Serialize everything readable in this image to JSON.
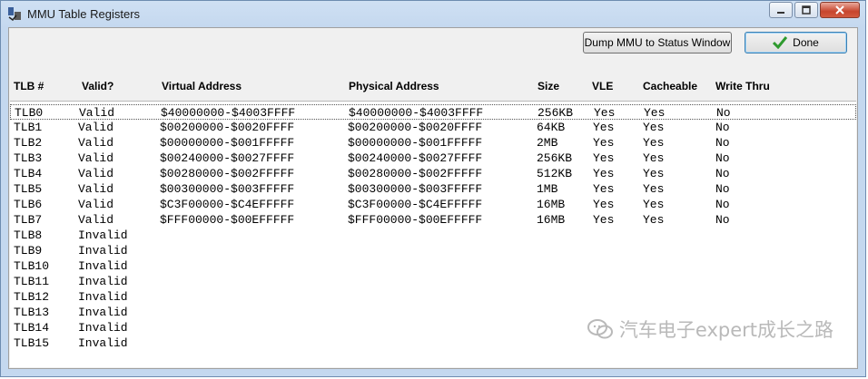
{
  "window": {
    "title": "MMU Table Registers",
    "buttons": {
      "dump": "Dump MMU to Status Window",
      "done": "Done"
    }
  },
  "columns": [
    "TLB #",
    "Valid?",
    "Virtual Address",
    "Physical Address",
    "Size",
    "VLE",
    "Cacheable",
    "Write Thru"
  ],
  "rows": [
    [
      "TLB0",
      "Valid",
      "$40000000-$4003FFFF",
      "$40000000-$4003FFFF",
      "256KB",
      "Yes",
      "Yes",
      "No"
    ],
    [
      "TLB1",
      "Valid",
      "$00200000-$0020FFFF",
      "$00200000-$0020FFFF",
      "64KB",
      "Yes",
      "Yes",
      "No"
    ],
    [
      "TLB2",
      "Valid",
      "$00000000-$001FFFFF",
      "$00000000-$001FFFFF",
      "2MB",
      "Yes",
      "Yes",
      "No"
    ],
    [
      "TLB3",
      "Valid",
      "$00240000-$0027FFFF",
      "$00240000-$0027FFFF",
      "256KB",
      "Yes",
      "Yes",
      "No"
    ],
    [
      "TLB4",
      "Valid",
      "$00280000-$002FFFFF",
      "$00280000-$002FFFFF",
      "512KB",
      "Yes",
      "Yes",
      "No"
    ],
    [
      "TLB5",
      "Valid",
      "$00300000-$003FFFFF",
      "$00300000-$003FFFFF",
      "1MB",
      "Yes",
      "Yes",
      "No"
    ],
    [
      "TLB6",
      "Valid",
      "$C3F00000-$C4EFFFFF",
      "$C3F00000-$C4EFFFFF",
      "16MB",
      "Yes",
      "Yes",
      "No"
    ],
    [
      "TLB7",
      "Valid",
      "$FFF00000-$00EFFFFF",
      "$FFF00000-$00EFFFFF",
      "16MB",
      "Yes",
      "Yes",
      "No"
    ],
    [
      "TLB8",
      "Invalid",
      "",
      "",
      "",
      "",
      "",
      ""
    ],
    [
      "TLB9",
      "Invalid",
      "",
      "",
      "",
      "",
      "",
      ""
    ],
    [
      "TLB10",
      "Invalid",
      "",
      "",
      "",
      "",
      "",
      ""
    ],
    [
      "TLB11",
      "Invalid",
      "",
      "",
      "",
      "",
      "",
      ""
    ],
    [
      "TLB12",
      "Invalid",
      "",
      "",
      "",
      "",
      "",
      ""
    ],
    [
      "TLB13",
      "Invalid",
      "",
      "",
      "",
      "",
      "",
      ""
    ],
    [
      "TLB14",
      "Invalid",
      "",
      "",
      "",
      "",
      "",
      ""
    ],
    [
      "TLB15",
      "Invalid",
      "",
      "",
      "",
      "",
      "",
      ""
    ]
  ],
  "selected_row": 0,
  "watermark": "汽车电子expert成长之路",
  "icons": {
    "app": "mmu-app-icon",
    "minimize": "minimize-icon",
    "maximize": "maximize-icon",
    "close": "close-icon",
    "done": "checkmark-icon",
    "watermark": "wechat-icon"
  },
  "colors": {
    "check": "#2e9a2e",
    "close_button": "#c7452d"
  }
}
